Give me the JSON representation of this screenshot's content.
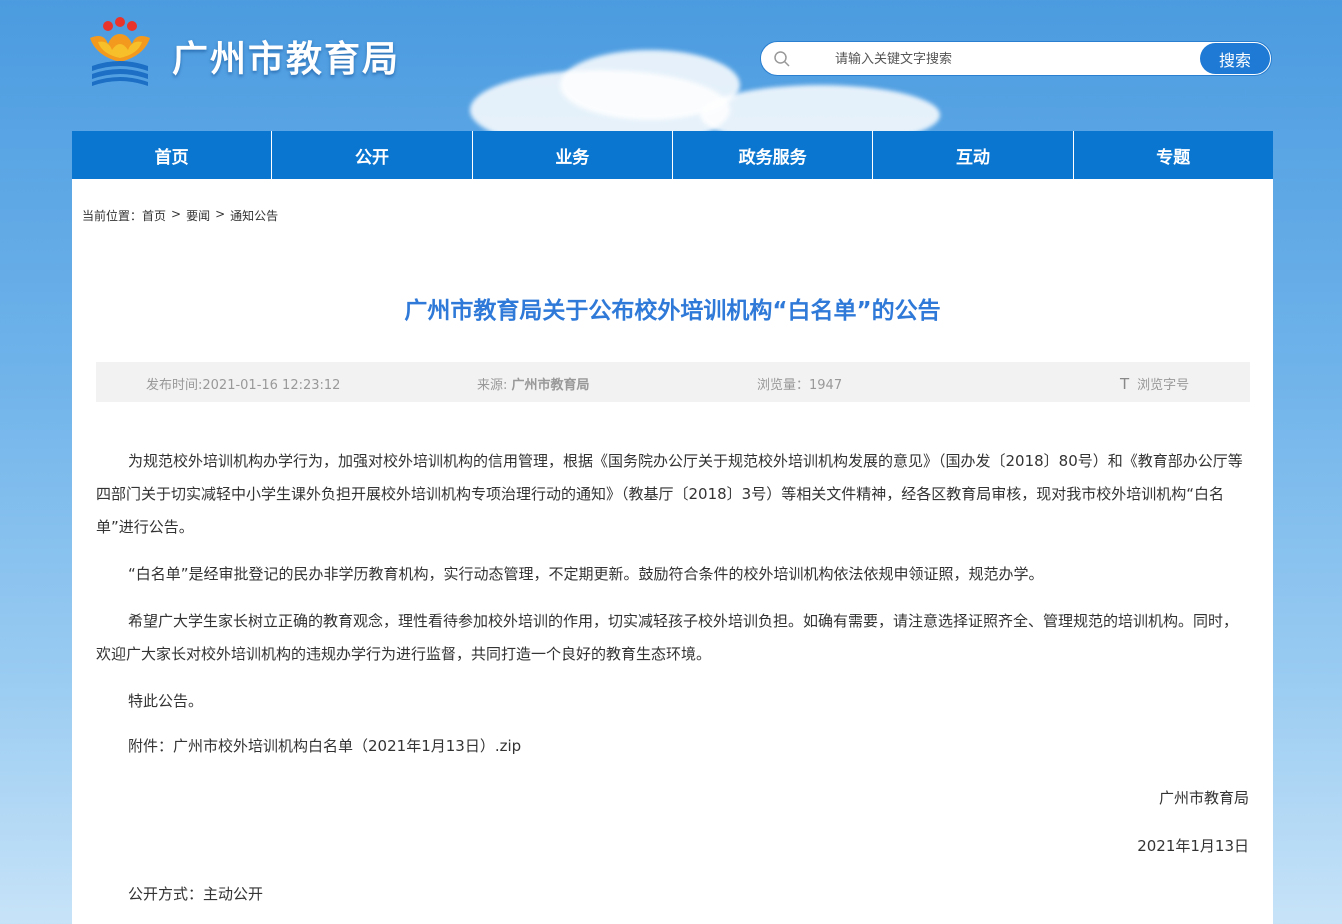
{
  "header": {
    "site_title": "广州市教育局",
    "search": {
      "placeholder": "请输入关键文字搜索",
      "button_label": "搜索"
    }
  },
  "nav": {
    "items": [
      {
        "label": "首页"
      },
      {
        "label": "公开"
      },
      {
        "label": "业务"
      },
      {
        "label": "政务服务"
      },
      {
        "label": "互动"
      },
      {
        "label": "专题"
      }
    ]
  },
  "breadcrumb": {
    "prefix": "当前位置：",
    "items": [
      "首页",
      "要闻",
      "通知公告"
    ],
    "separator": ">"
  },
  "article": {
    "title": "广州市教育局关于公布校外培训机构“白名单”的公告",
    "meta": {
      "publish_time": "发布时间:2021-01-16 12:23:12",
      "source_label": "来源: ",
      "source_value": "广州市教育局",
      "views": "浏览量：1947",
      "font_toggle_icon": "T",
      "font_toggle_label": "浏览字号"
    },
    "paragraphs": [
      "为规范校外培训机构办学行为，加强对校外培训机构的信用管理，根据《国务院办公厅关于规范校外培训机构发展的意见》（国办发〔2018〕80号）和《教育部办公厅等四部门关于切实减轻中小学生课外负担开展校外培训机构专项治理行动的通知》（教基厅〔2018〕3号）等相关文件精神，经各区教育局审核，现对我市校外培训机构“白名单”进行公告。",
      "“白名单”是经审批登记的民办非学历教育机构，实行动态管理，不定期更新。鼓励符合条件的校外培训机构依法依规申领证照，规范办学。",
      "希望广大学生家长树立正确的教育观念，理性看待参加校外培训的作用，切实减轻孩子校外培训负担。如确有需要，请注意选择证照齐全、管理规范的培训机构。同时，欢迎广大家长对校外培训机构的违规办学行为进行监督，共同打造一个良好的教育生态环境。",
      "特此公告。"
    ],
    "attachment_label": "附件：",
    "attachment_link": "广州市校外培训机构白名单（2021年1月13日）.zip",
    "sign_org": "广州市教育局",
    "sign_date": "2021年1月13日",
    "open_method": "公开方式：主动公开"
  },
  "colors": {
    "nav_bg": "#0b76d0",
    "title": "#2f7ad8",
    "search_button": "#1e7ad4"
  }
}
